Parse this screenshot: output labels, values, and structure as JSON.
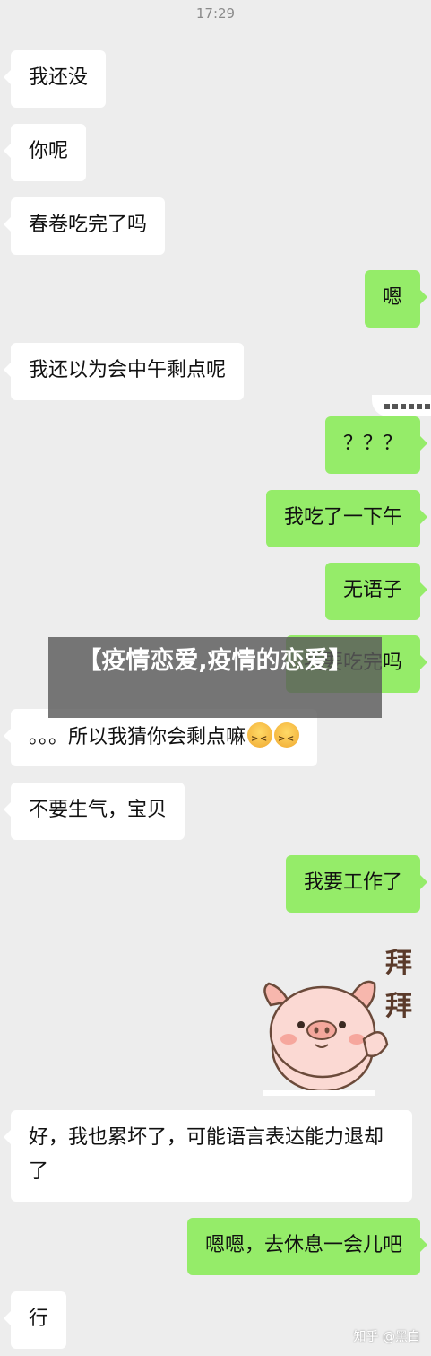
{
  "timestamp": "17:29",
  "messages": {
    "m1": "我还没",
    "m2": "你呢",
    "m3": "春卷吃完了吗",
    "m4": "嗯",
    "m5": "我还以为会中午剩点呢",
    "m6": "？？？",
    "m7": "我吃了一下午",
    "m8": "无语子",
    "m9": "我要吃完吗",
    "m10": "。。。所以我猜你会剩点嘛",
    "m11": "不要生气，宝贝",
    "m12": "我要工作了",
    "m13": "好，我也累坏了，可能语言表达能力退却了",
    "m14": "嗯嗯，去休息一会儿吧",
    "m15": "行"
  },
  "sticker": {
    "line1": "拜",
    "line2": "拜"
  },
  "overlay_banner": "【疫情恋爱,疫情的恋爱】",
  "watermark": "知乎 @黑白",
  "colors": {
    "chat_bg": "#ededed",
    "received": "#ffffff",
    "sent": "#95ec69"
  }
}
